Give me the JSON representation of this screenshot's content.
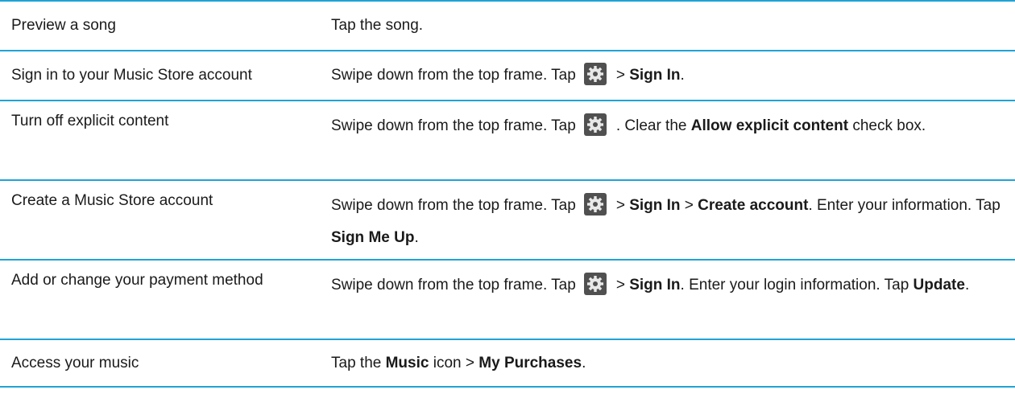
{
  "colors": {
    "rule": "#1fa3d6",
    "gear_bg": "#505050",
    "gear_fg": "#e8e8e8"
  },
  "icons": {
    "settings": "gear-icon"
  },
  "rows": [
    {
      "task": "Preview a song",
      "action": [
        {
          "t": "Tap the song."
        }
      ]
    },
    {
      "task": "Sign in to your Music Store account",
      "action": [
        {
          "t": "Swipe down from the top frame. Tap"
        },
        {
          "icon": "gear-icon"
        },
        {
          "t": "> "
        },
        {
          "b": "Sign In"
        },
        {
          "t": "."
        }
      ]
    },
    {
      "task": "Turn off explicit content",
      "action": [
        {
          "t": "Swipe down from the top frame. Tap"
        },
        {
          "icon": "gear-icon"
        },
        {
          "t": ". Clear the "
        },
        {
          "b": "Allow explicit content"
        },
        {
          "t": " check box."
        }
      ]
    },
    {
      "task": "Create a Music Store account",
      "action": [
        {
          "t": "Swipe down from the top frame. Tap"
        },
        {
          "icon": "gear-icon"
        },
        {
          "t": "> "
        },
        {
          "b": "Sign In"
        },
        {
          "t": " > "
        },
        {
          "b": "Create account"
        },
        {
          "t": ". Enter your information. Tap "
        },
        {
          "b": "Sign Me Up"
        },
        {
          "t": "."
        }
      ]
    },
    {
      "task": "Add or change your payment method",
      "action": [
        {
          "t": "Swipe down from the top frame. Tap"
        },
        {
          "icon": "gear-icon"
        },
        {
          "t": "> "
        },
        {
          "b": "Sign In"
        },
        {
          "t": ". Enter your login information. Tap "
        },
        {
          "b": "Update"
        },
        {
          "t": "."
        }
      ]
    },
    {
      "task": "Access your music",
      "action": [
        {
          "t": "Tap the "
        },
        {
          "b": "Music"
        },
        {
          "t": " icon > "
        },
        {
          "b": "My Purchases"
        },
        {
          "t": "."
        }
      ]
    }
  ]
}
